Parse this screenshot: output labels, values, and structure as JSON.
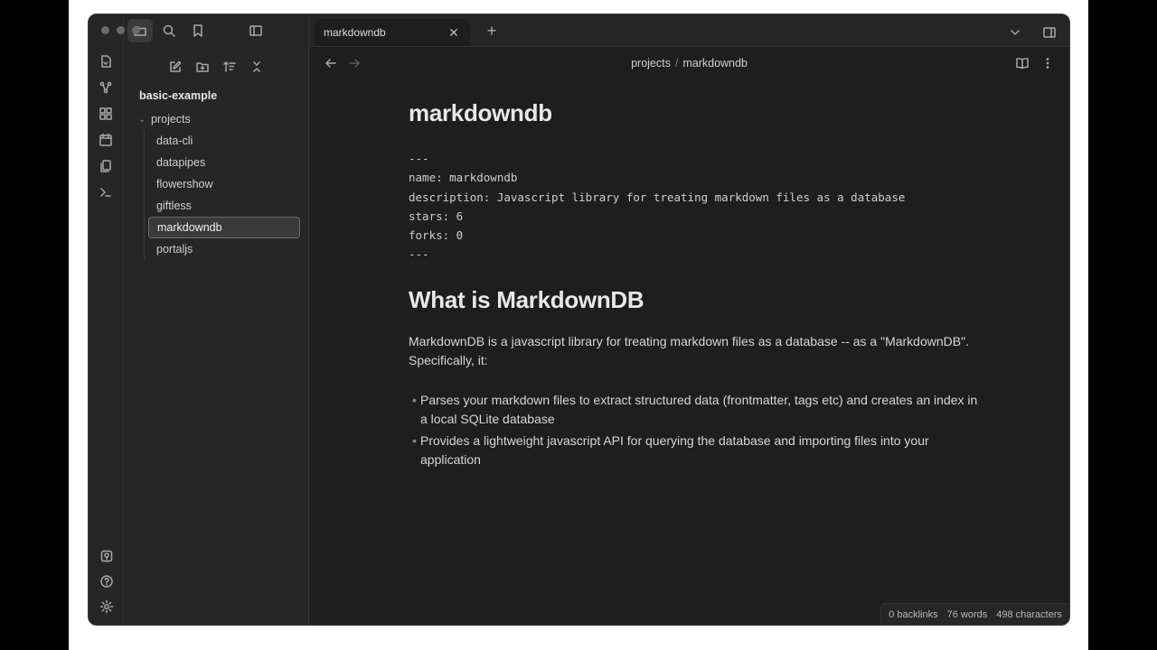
{
  "tab": {
    "title": "markdowndb"
  },
  "sidebar": {
    "vault_name": "basic-example",
    "folder": {
      "name": "projects"
    },
    "files": [
      {
        "name": "data-cli"
      },
      {
        "name": "datapipes"
      },
      {
        "name": "flowershow"
      },
      {
        "name": "giftless"
      },
      {
        "name": "markdowndb"
      },
      {
        "name": "portaljs"
      }
    ],
    "active_file": "markdowndb"
  },
  "breadcrumb": {
    "parent": "projects",
    "separator": "/",
    "current": "markdowndb"
  },
  "note": {
    "title": "markdowndb",
    "frontmatter": [
      "---",
      "name: markdowndb",
      "description: Javascript library for treating markdown files as a database",
      "stars: 6",
      "forks: 0",
      "---"
    ],
    "heading": "What is MarkdownDB",
    "paragraph": "MarkdownDB is a javascript library for treating markdown files as a database -- as a \"MarkdownDB\". Specifically, it:",
    "bullets": [
      "Parses your markdown files to extract structured data (frontmatter, tags etc) and creates an index in a local SQLite database",
      "Provides a lightweight javascript API for querying the database and importing files into your application"
    ]
  },
  "status": {
    "backlinks": "0 backlinks",
    "words": "76 words",
    "characters": "498 characters"
  }
}
